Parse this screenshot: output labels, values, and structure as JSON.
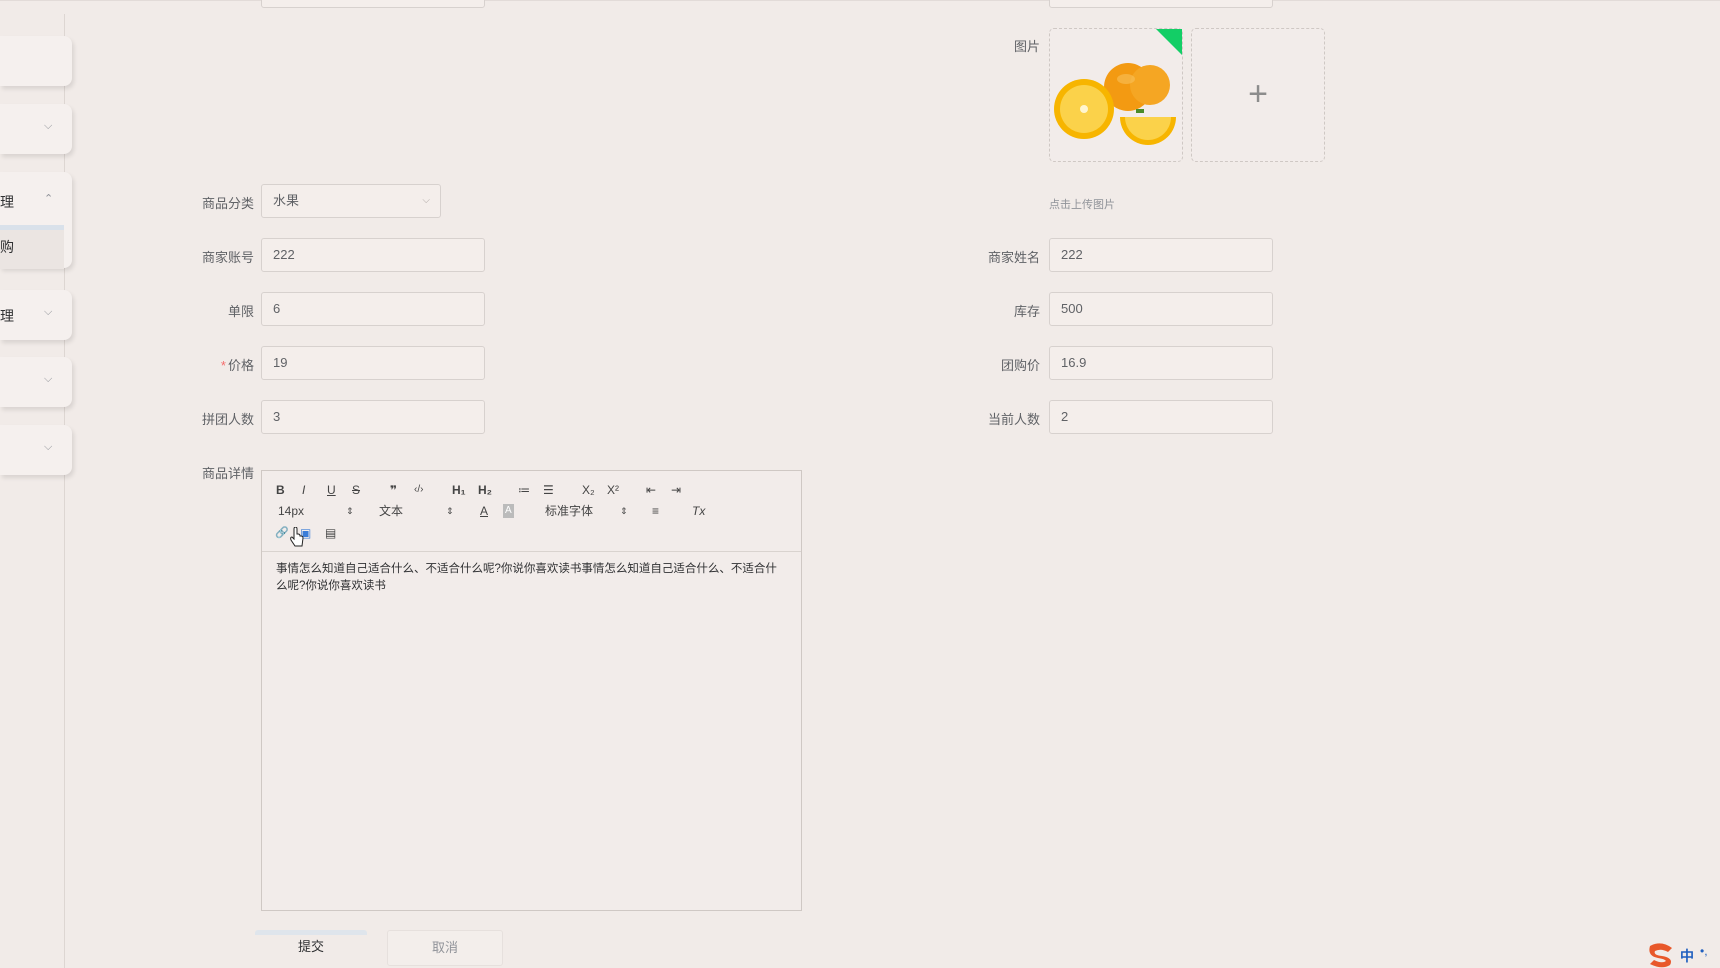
{
  "sidebar": {
    "items": [
      {
        "label": "",
        "arrow": ""
      },
      {
        "label": "",
        "arrow": "⌵"
      },
      {
        "label": "理",
        "arrow": "⌃"
      },
      {
        "label": "购",
        "arrow": ""
      },
      {
        "label": "理",
        "arrow": "⌵"
      },
      {
        "label": "",
        "arrow": "⌵"
      },
      {
        "label": "",
        "arrow": "⌵"
      }
    ]
  },
  "form": {
    "image_label": "图片",
    "upload_tip": "点击上传图片",
    "upload_plus": "+",
    "category": {
      "label": "商品分类",
      "value": "水果",
      "icon": "chevron-down-icon"
    },
    "merchant_account": {
      "label": "商家账号",
      "value": "222"
    },
    "merchant_name": {
      "label": "商家姓名",
      "value": "222"
    },
    "limit": {
      "label": "单限",
      "value": "6"
    },
    "stock": {
      "label": "库存",
      "value": "500"
    },
    "price": {
      "label": "价格",
      "required_mark": "*",
      "value": "19"
    },
    "group_price": {
      "label": "团购价",
      "value": "16.9"
    },
    "group_size": {
      "label": "拼团人数",
      "value": "3"
    },
    "current_count": {
      "label": "当前人数",
      "value": "2"
    },
    "detail": {
      "label": "商品详情",
      "toolbar": {
        "bold": "B",
        "italic": "I",
        "underline": "U",
        "strike": "S",
        "quote": "❞",
        "code": "‹/›",
        "h1": "H₁",
        "h2": "H₂",
        "ordered_list": "≔",
        "bullet_list": "☰",
        "sub": "X₂",
        "sup": "X²",
        "outdent": "⇤",
        "indent": "⇥",
        "size": "14px",
        "header": "文本",
        "font_color": "A",
        "bg_color": "A",
        "font": "标准字体",
        "align": "≡",
        "clean": "Tx",
        "link": "🔗",
        "image": "▣",
        "video": "▤"
      },
      "content": "事情怎么知道自己适合什么、不适合什么呢?你说你喜欢读书事情怎么知道自己适合什么、不适合什么呢?你说你喜欢读书"
    }
  },
  "buttons": {
    "submit": "提交",
    "cancel": "取消"
  },
  "ime": {
    "label": "中",
    "dots": "•,"
  }
}
